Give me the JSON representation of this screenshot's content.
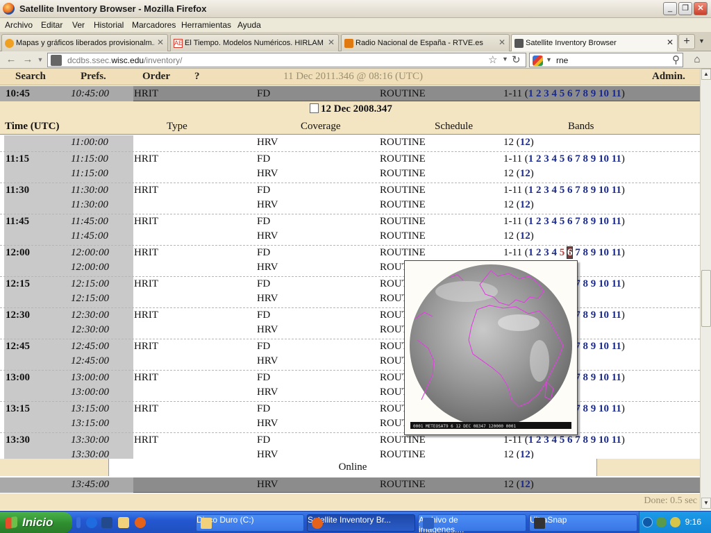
{
  "window": {
    "title": "Satellite Inventory Browser - Mozilla Firefox"
  },
  "menu": [
    "Archivo",
    "Editar",
    "Ver",
    "Historial",
    "Marcadores",
    "Herramientas",
    "Ayuda"
  ],
  "tabs": [
    {
      "label": "Mapas y gráficos liberados provisionalm...",
      "icon_color": "#f0a020"
    },
    {
      "label": "El Tiempo. Modelos Numéricos. HIRLAM ...",
      "icon_color": "#d23a2a"
    },
    {
      "label": "Radio Nacional de España - RTVE.es",
      "icon_color": "#e07a10"
    },
    {
      "label": "Satellite Inventory Browser",
      "icon_color": "#555555",
      "active": true
    }
  ],
  "nav": {
    "url_prefix": "dcdbs.ssec.",
    "url_domain": "wisc.edu",
    "url_path": "/inventory/",
    "search_query": "rne"
  },
  "page": {
    "topnav": {
      "search": "Search",
      "prefs": "Prefs.",
      "order": "Order",
      "help": "?",
      "date": "11 Dec 2011.346 @ 08:16 (UTC)",
      "admin": "Admin."
    },
    "top_row": {
      "t1": "10:45",
      "t2": "10:45:00",
      "type": "HRIT",
      "coverage": "FD",
      "schedule": "ROUTINE",
      "band_prefix": "1-11 (",
      "band_suffix": ")"
    },
    "date_header": "12 Dec 2008.347",
    "columns": {
      "time": "Time (UTC)",
      "type": "Type",
      "coverage": "Coverage",
      "schedule": "Schedule",
      "bands": "Bands"
    },
    "band_links": [
      "1",
      "2",
      "3",
      "4",
      "5",
      "6",
      "7",
      "8",
      "9",
      "10",
      "11"
    ],
    "hrv_band": "12",
    "rows": [
      {
        "t1": "",
        "t2": "11:00:00",
        "type": "",
        "coverage": "HRV",
        "schedule": "ROUTINE",
        "kind": "hrv"
      },
      {
        "t1": "11:15",
        "t2": "11:15:00",
        "type": "HRIT",
        "coverage": "FD",
        "schedule": "ROUTINE",
        "kind": "fd"
      },
      {
        "t1": "",
        "t2": "11:15:00",
        "type": "",
        "coverage": "HRV",
        "schedule": "ROUTINE",
        "kind": "hrv"
      },
      {
        "t1": "11:30",
        "t2": "11:30:00",
        "type": "HRIT",
        "coverage": "FD",
        "schedule": "ROUTINE",
        "kind": "fd"
      },
      {
        "t1": "",
        "t2": "11:30:00",
        "type": "",
        "coverage": "HRV",
        "schedule": "ROUTINE",
        "kind": "hrv"
      },
      {
        "t1": "11:45",
        "t2": "11:45:00",
        "type": "HRIT",
        "coverage": "FD",
        "schedule": "ROUTINE",
        "kind": "fd"
      },
      {
        "t1": "",
        "t2": "11:45:00",
        "type": "",
        "coverage": "HRV",
        "schedule": "ROUTINE",
        "kind": "hrv"
      },
      {
        "t1": "12:00",
        "t2": "12:00:00",
        "type": "HRIT",
        "coverage": "FD",
        "schedule": "ROUTINE",
        "kind": "fd",
        "visited": [
          "5"
        ],
        "hot": "6"
      },
      {
        "t1": "",
        "t2": "12:00:00",
        "type": "",
        "coverage": "HRV",
        "schedule": "ROUTINE",
        "kind": "hrv"
      },
      {
        "t1": "12:15",
        "t2": "12:15:00",
        "type": "HRIT",
        "coverage": "FD",
        "schedule": "ROUTINE",
        "kind": "fd"
      },
      {
        "t1": "",
        "t2": "12:15:00",
        "type": "",
        "coverage": "HRV",
        "schedule": "ROUTINE",
        "kind": "hrv"
      },
      {
        "t1": "12:30",
        "t2": "12:30:00",
        "type": "HRIT",
        "coverage": "FD",
        "schedule": "ROUTINE",
        "kind": "fd"
      },
      {
        "t1": "",
        "t2": "12:30:00",
        "type": "",
        "coverage": "HRV",
        "schedule": "ROUTINE",
        "kind": "hrv"
      },
      {
        "t1": "12:45",
        "t2": "12:45:00",
        "type": "HRIT",
        "coverage": "FD",
        "schedule": "ROUTINE",
        "kind": "fd"
      },
      {
        "t1": "",
        "t2": "12:45:00",
        "type": "",
        "coverage": "HRV",
        "schedule": "ROUTINE",
        "kind": "hrv"
      },
      {
        "t1": "13:00",
        "t2": "13:00:00",
        "type": "HRIT",
        "coverage": "FD",
        "schedule": "ROUTINE",
        "kind": "fd"
      },
      {
        "t1": "",
        "t2": "13:00:00",
        "type": "",
        "coverage": "HRV",
        "schedule": "ROUTINE",
        "kind": "hrv"
      },
      {
        "t1": "13:15",
        "t2": "13:15:00",
        "type": "HRIT",
        "coverage": "FD",
        "schedule": "ROUTINE",
        "kind": "fd"
      },
      {
        "t1": "",
        "t2": "13:15:00",
        "type": "",
        "coverage": "HRV",
        "schedule": "ROUTINE",
        "kind": "hrv"
      },
      {
        "t1": "13:30",
        "t2": "13:30:00",
        "type": "HRIT",
        "coverage": "FD",
        "schedule": "ROUTINE",
        "kind": "fd"
      },
      {
        "t1": "",
        "t2": "13:30:00",
        "type": "",
        "coverage": "HRV",
        "schedule": "ROUTINE",
        "kind": "hrv"
      }
    ],
    "online_label": "Online",
    "bottom_row": {
      "t2": "13:45:00",
      "coverage": "HRV",
      "schedule": "ROUTINE",
      "band_prefix": "12 (",
      "band": "12",
      "band_suffix": ")"
    },
    "popup_caption": "0001 METEOSAT9  6 12 DEC 08347  120000 0001"
  },
  "status": {
    "text": "Done: 0.5 sec"
  },
  "taskbar": {
    "start": "Inicio",
    "buttons": [
      {
        "label": "Disco Duro (C:)",
        "icon_color": "#f1d27a"
      },
      {
        "label": "Satellite Inventory Br...",
        "icon_color": "#e5621a",
        "active": true
      },
      {
        "label": "Archivo de imágenes....",
        "icon_color": "#2b5fc0"
      },
      {
        "label": "UltraSnap",
        "icon_color": "#333333"
      }
    ],
    "clock": "9:16"
  }
}
